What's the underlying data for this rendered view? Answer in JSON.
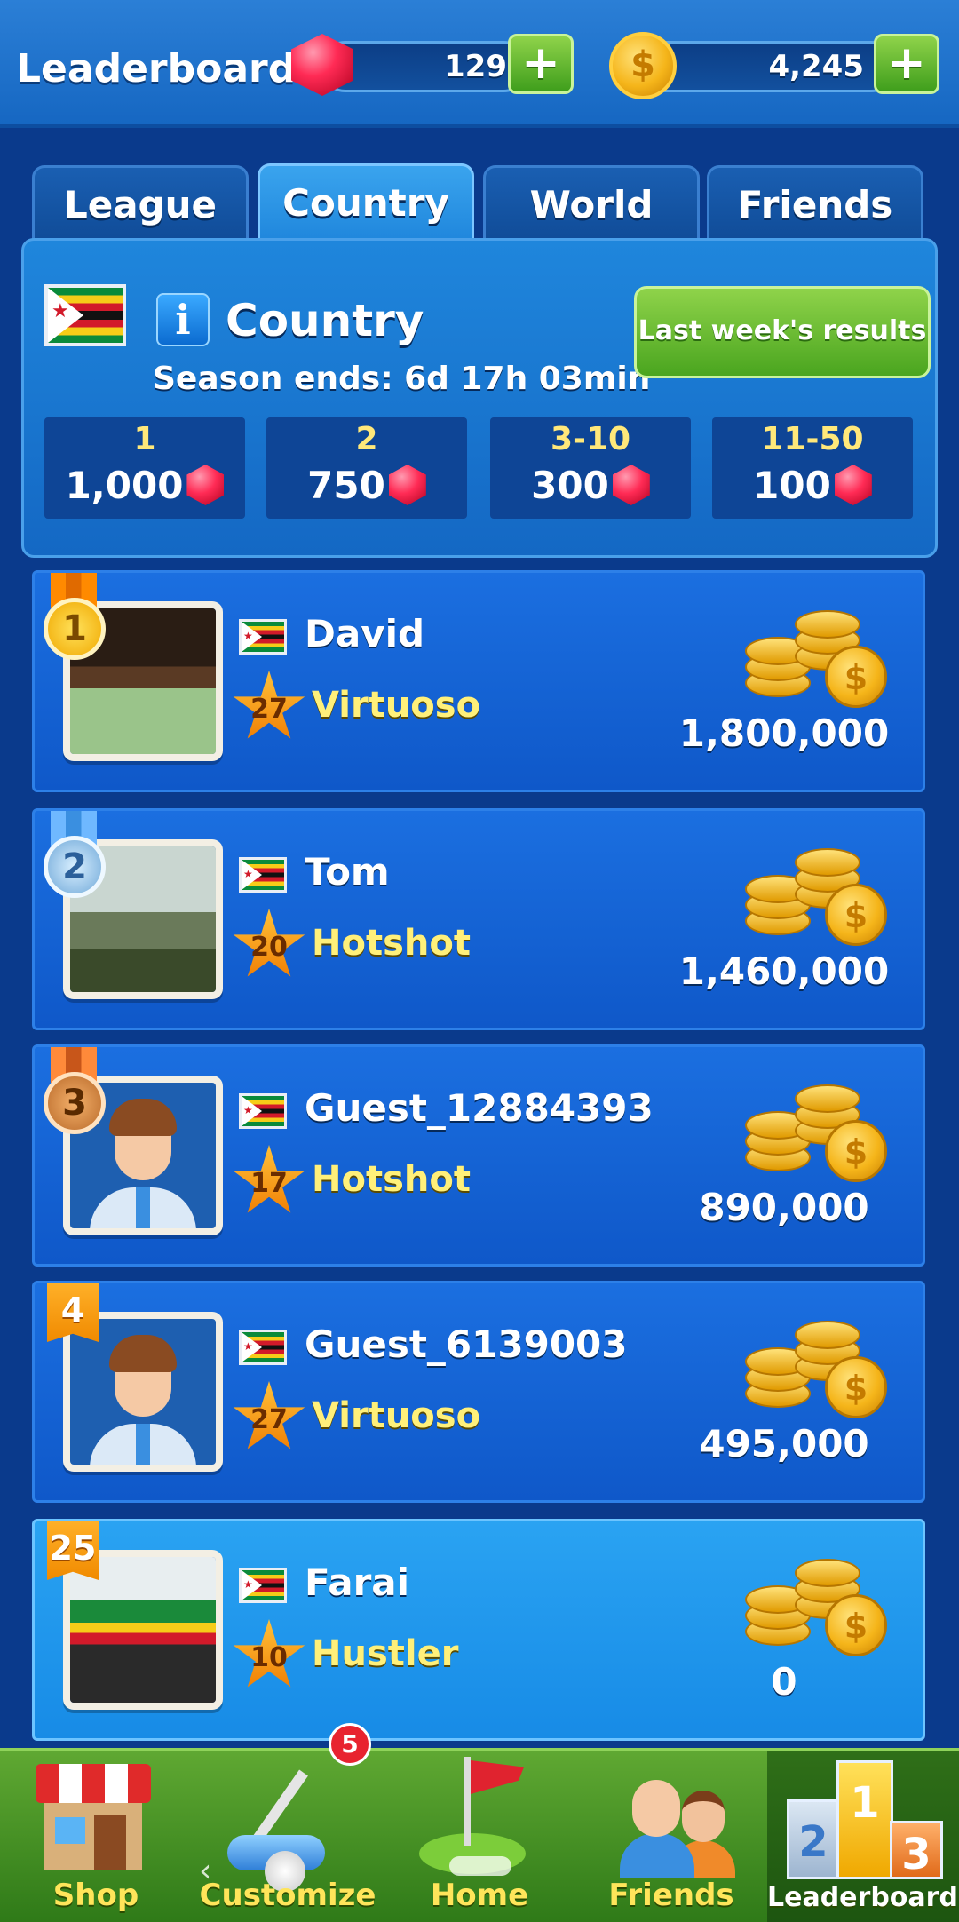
{
  "header": {
    "title": "Leaderboards",
    "gems": "129",
    "coins": "4,245",
    "plus_label": "+",
    "coin_symbol": "$"
  },
  "tabs": [
    {
      "label": "League",
      "active": false
    },
    {
      "label": "Country",
      "active": true
    },
    {
      "label": "World",
      "active": false
    },
    {
      "label": "Friends",
      "active": false
    }
  ],
  "panel": {
    "info_symbol": "i",
    "title": "Country",
    "season": "Season ends: 6d 17h 03min",
    "last_week_button": "Last week's results",
    "prizes": [
      {
        "rank": "1",
        "reward": "1,000"
      },
      {
        "rank": "2",
        "reward": "750"
      },
      {
        "rank": "3-10",
        "reward": "300"
      },
      {
        "rank": "11-50",
        "reward": "100"
      }
    ]
  },
  "players": [
    {
      "position": "1",
      "name": "David",
      "level": "27",
      "title": "Virtuoso",
      "score": "1,800,000"
    },
    {
      "position": "2",
      "name": "Tom",
      "level": "20",
      "title": "Hotshot",
      "score": "1,460,000"
    },
    {
      "position": "3",
      "name": "Guest_12884393",
      "level": "17",
      "title": "Hotshot",
      "score": "890,000"
    },
    {
      "position": "4",
      "name": "Guest_6139003",
      "level": "27",
      "title": "Virtuoso",
      "score": "495,000"
    },
    {
      "position": "25",
      "name": "Farai",
      "level": "10",
      "title": "Hustler",
      "score": "0"
    }
  ],
  "bottom_nav": {
    "items": [
      {
        "label": "Shop",
        "icon": "shop-icon"
      },
      {
        "label": "Customize",
        "icon": "golf-club-icon"
      },
      {
        "label": "Home",
        "icon": "golf-flag-icon"
      },
      {
        "label": "Friends",
        "icon": "friends-icon"
      },
      {
        "label": "Leaderboards",
        "icon": "podium-icon",
        "active": true
      }
    ],
    "customize_badge": "5",
    "podium_ranks": [
      "1",
      "2",
      "3"
    ]
  },
  "system": {
    "back_glyph": "‹"
  },
  "colors": {
    "accent_green": "#4aa51f",
    "tab_active": "#1f86dc",
    "row_bg": "#0f58c9",
    "title_yellow": "#fff07a",
    "gem_red": "#ff2b55",
    "coin_gold": "#f5b51a"
  }
}
